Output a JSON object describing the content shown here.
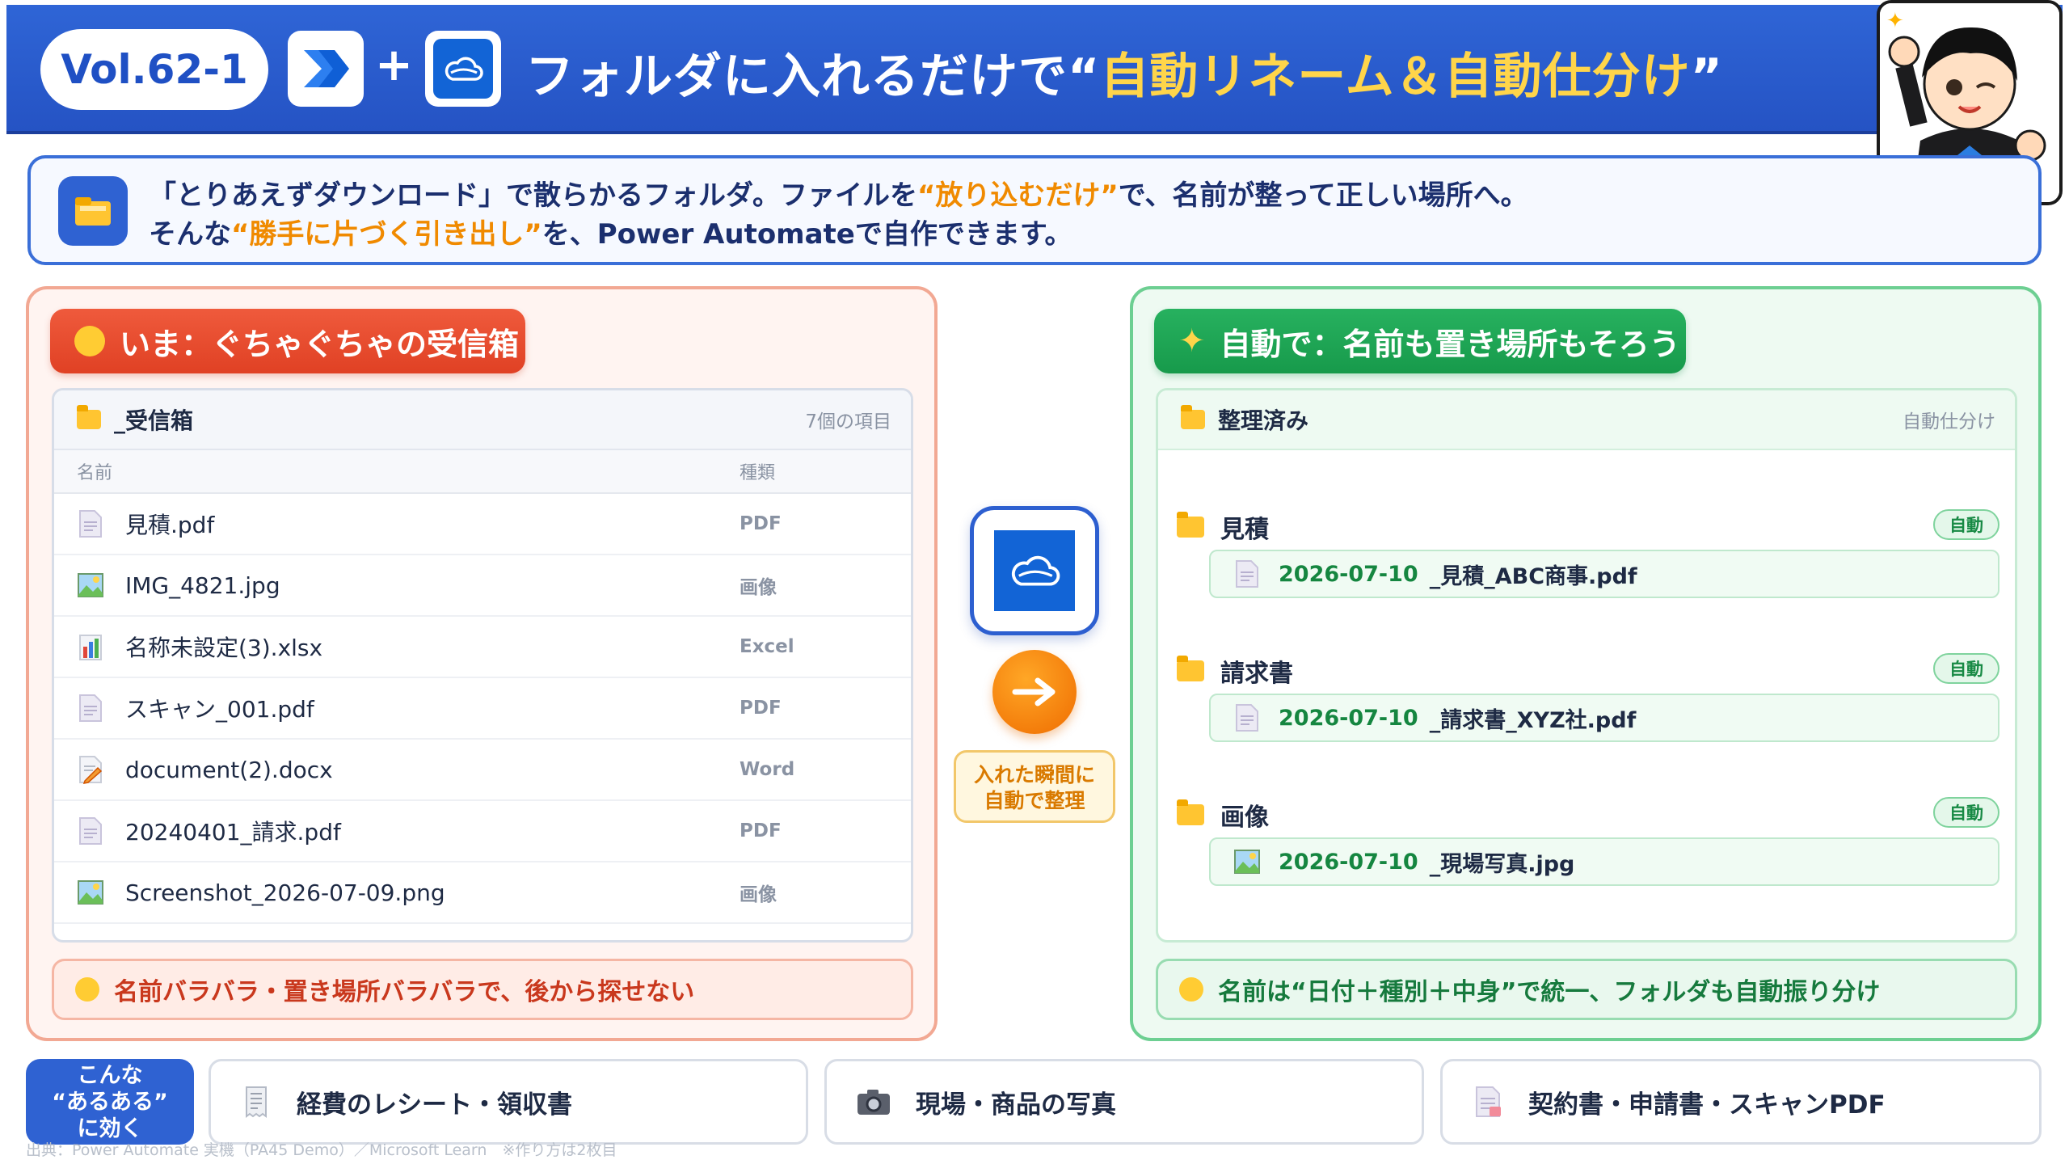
{
  "header": {
    "vol": "Vol.62-1",
    "plus": "+",
    "title_pre": "フォルダに入れるだけで“",
    "title_hl": "自動リネーム＆自動仕分け",
    "title_post": "”"
  },
  "intro": {
    "line1_pre": "「とりあえずダウンロード」で散らかるフォルダ。ファイルを",
    "line1_hl": "“放り込むだけ”",
    "line1_post": "で、名前が整って正しい場所へ。",
    "line2_pre": "そんな",
    "line2_hl": "“勝手に片づく引き出し”",
    "line2_post": "を、Power Automateで自作できます。"
  },
  "left": {
    "pill": "いま：ぐちゃぐちゃの受信箱",
    "folder_name": "_受信箱",
    "item_count": "7個の項目",
    "col_name": "名前",
    "col_type": "種類",
    "files": [
      {
        "name": "見積.pdf",
        "type": "PDF",
        "icon": "pdf-icon"
      },
      {
        "name": "IMG_4821.jpg",
        "type": "画像",
        "icon": "image-icon"
      },
      {
        "name": "名称未設定(3).xlsx",
        "type": "Excel",
        "icon": "excel-icon"
      },
      {
        "name": "スキャン_001.pdf",
        "type": "PDF",
        "icon": "pdf-icon"
      },
      {
        "name": "document(2).docx",
        "type": "Word",
        "icon": "word-icon"
      },
      {
        "name": "20240401_請求.pdf",
        "type": "PDF",
        "icon": "pdf-icon"
      },
      {
        "name": "Screenshot_2026-07-09.png",
        "type": "画像",
        "icon": "image-icon"
      }
    ],
    "bottom": "名前バラバラ・置き場所バラバラで、後から探せない"
  },
  "center": {
    "note_line1": "入れた瞬間に",
    "note_line2": "自動で整理"
  },
  "right": {
    "pill": "自動で：名前も置き場所もそろう",
    "folder_name": "整理済み",
    "meta": "自動仕分け",
    "groups": [
      {
        "title": "見積",
        "badge": "自動",
        "date": "2026-07-10",
        "file": "_見積_ABC商事.pdf",
        "icon": "pdf-icon"
      },
      {
        "title": "請求書",
        "badge": "自動",
        "date": "2026-07-10",
        "file": "_請求書_XYZ社.pdf",
        "icon": "pdf-icon"
      },
      {
        "title": "画像",
        "badge": "自動",
        "date": "2026-07-10",
        "file": "_現場写真.jpg",
        "icon": "image-icon"
      }
    ],
    "bottom": "名前は“日付＋種別＋中身”で統一、フォルダも自動振り分け"
  },
  "footer": {
    "aruaru_line1": "こんな",
    "aruaru_line2": "“あるある”",
    "aruaru_line3": "に効く",
    "chips": [
      {
        "label": "経費のレシート・領収書",
        "icon": "receipt-icon"
      },
      {
        "label": "現場・商品の写真",
        "icon": "camera-icon"
      },
      {
        "label": "契約書・申請書・スキャンPDF",
        "icon": "document-icon"
      }
    ],
    "source": "出典：Power Automate 実機（PA45 Demo）／Microsoft Learn　※作り方は2枚目"
  },
  "colors": {
    "brand_blue": "#2f62d2",
    "accent_yellow": "#ffd54a",
    "accent_orange": "#f08a00",
    "bad_red": "#e04124",
    "good_green": "#179a4b"
  }
}
